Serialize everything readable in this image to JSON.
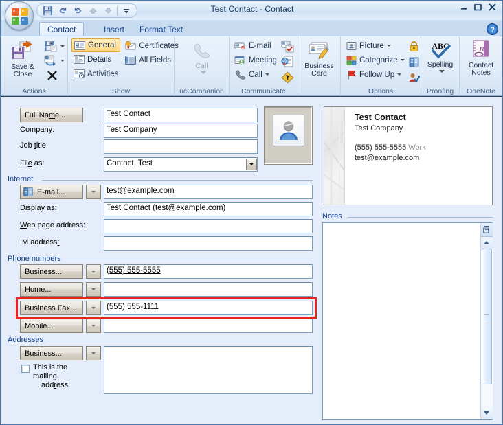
{
  "window": {
    "title": "Test Contact - Contact",
    "minimize_label": "Minimize",
    "maximize_label": "Maximize",
    "close_label": "Close"
  },
  "quick_access": {
    "items": [
      {
        "name": "save",
        "label": "Save"
      },
      {
        "name": "undo",
        "label": "Undo"
      },
      {
        "name": "redo",
        "label": "Redo"
      },
      {
        "name": "previous-item",
        "label": "Previous Item"
      },
      {
        "name": "next-item",
        "label": "Next Item"
      },
      {
        "name": "customize",
        "label": "Customize Quick Access Toolbar"
      }
    ]
  },
  "tabs": [
    {
      "label": "Contact",
      "active": true
    },
    {
      "label": "Insert",
      "active": false
    },
    {
      "label": "Format Text",
      "active": false
    }
  ],
  "help": {
    "label": "?"
  },
  "ribbon": {
    "groups": [
      {
        "name": "actions",
        "label": "Actions",
        "big": [
          {
            "label": "Save &\nClose",
            "line1": "Save &",
            "line2": "Close"
          }
        ],
        "small": [
          {
            "label": "Save & New",
            "has_caret": true
          },
          {
            "label": "Send",
            "has_caret": true
          },
          {
            "label": "Delete",
            "has_caret": false
          }
        ]
      },
      {
        "name": "show",
        "label": "Show",
        "items": [
          {
            "label": "General",
            "selected": true
          },
          {
            "label": "Certificates",
            "selected": false
          },
          {
            "label": "Details",
            "selected": false
          },
          {
            "label": "All Fields",
            "selected": false
          },
          {
            "label": "Activities",
            "selected": false
          }
        ]
      },
      {
        "name": "uccompanion",
        "label": "ucCompanion",
        "big": [
          {
            "label": "Call",
            "disabled": true
          }
        ]
      },
      {
        "name": "communicate",
        "label": "Communicate",
        "items": [
          {
            "label": "E-mail",
            "has_caret": false
          },
          {
            "label": "Meeting",
            "has_caret": false
          },
          {
            "label": "Call",
            "has_caret": true
          }
        ],
        "mini": [
          {
            "name": "assign-task-icon",
            "label": "Assign Task"
          },
          {
            "name": "web-page-icon",
            "label": "Web Page"
          },
          {
            "name": "map-it-icon",
            "label": "Map It"
          }
        ]
      },
      {
        "name": "business-card",
        "label": "",
        "big": [
          {
            "line1": "Business",
            "line2": "Card"
          }
        ]
      },
      {
        "name": "options",
        "label": "Options",
        "items": [
          {
            "label": "Picture",
            "has_caret": true
          },
          {
            "label": "Categorize",
            "has_caret": true
          },
          {
            "label": "Follow Up",
            "has_caret": true
          }
        ],
        "mini": [
          {
            "name": "private-icon",
            "label": "Private"
          },
          {
            "name": "address-book-icon",
            "label": "Check Names"
          },
          {
            "name": "permission-icon",
            "label": "Permission"
          }
        ]
      },
      {
        "name": "proofing",
        "label": "Proofing",
        "big": [
          {
            "label": "Spelling",
            "has_caret": true
          }
        ]
      },
      {
        "name": "onenote",
        "label": "OneNote",
        "big": [
          {
            "line1": "Contact",
            "line2": "Notes"
          }
        ]
      }
    ]
  },
  "form": {
    "full_name": {
      "button_label": "Full Name...",
      "accel": "m",
      "value": "Test Contact"
    },
    "company": {
      "label": "Company:",
      "accel": "a",
      "value": "Test Company"
    },
    "job_title": {
      "label": "Job title:",
      "accel": "t",
      "value": ""
    },
    "file_as": {
      "label": "File as:",
      "accel": "e",
      "value": "Contact, Test"
    },
    "internet": {
      "section_label": "Internet",
      "email": {
        "button_label": "E-mail...",
        "value": "test@example.com"
      },
      "display_as": {
        "label": "Display as:",
        "accel": "i",
        "value": "Test Contact (test@example.com)"
      },
      "web_page": {
        "label": "Web page address:",
        "accel": "W",
        "value": ""
      },
      "im_address": {
        "label": "IM address:",
        "value": ""
      }
    },
    "phone_numbers": {
      "section_label": "Phone numbers",
      "rows": [
        {
          "button_label": "Business...",
          "value": "(555) 555-5555",
          "highlighted": false
        },
        {
          "button_label": "Home...",
          "value": "",
          "highlighted": false
        },
        {
          "button_label": "Business Fax...",
          "value": "(555) 555-1111",
          "highlighted": true
        },
        {
          "button_label": "Mobile...",
          "value": "",
          "highlighted": false
        }
      ]
    },
    "addresses": {
      "section_label": "Addresses",
      "button_label": "Business...",
      "value": "",
      "checkbox": {
        "line1": "This is the mailing",
        "line2": "address",
        "checked": false
      }
    },
    "photo": {
      "name": "contact-photo-placeholder"
    },
    "business_card": {
      "name": "Test Contact",
      "company": "Test Company",
      "phone": "(555) 555-5555",
      "phone_tag": "Work",
      "email": "test@example.com"
    },
    "notes": {
      "section_label": "Notes",
      "value": ""
    }
  },
  "colors": {
    "annotation": "#e8241f",
    "accent": "#15428b",
    "form_bg": "#e4edf9",
    "selected_ribbon": "#ffd479"
  }
}
